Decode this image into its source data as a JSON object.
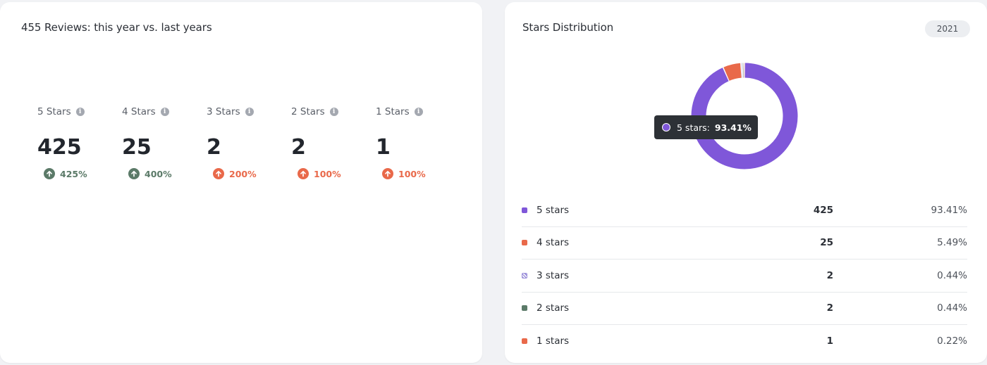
{
  "reviews_card": {
    "title": "455 Reviews: this year vs. last years",
    "stats": [
      {
        "label": "5 Stars",
        "value": "425",
        "change": "425%",
        "trend_color": "#5b7a68"
      },
      {
        "label": "4 Stars",
        "value": "25",
        "change": "400%",
        "trend_color": "#5b7a68"
      },
      {
        "label": "3 Stars",
        "value": "2",
        "change": "200%",
        "trend_color": "#e9694a"
      },
      {
        "label": "2 Stars",
        "value": "2",
        "change": "100%",
        "trend_color": "#e9694a"
      },
      {
        "label": "1 Stars",
        "value": "1",
        "change": "100%",
        "trend_color": "#e9694a"
      }
    ],
    "info_icon": "info-icon",
    "trend_icon": "arrow-up-circle-icon"
  },
  "distribution_card": {
    "title": "Stars Distribution",
    "year_badge": "2021",
    "tooltip": {
      "label": "5 stars:",
      "value": "93.41%"
    },
    "rows": [
      {
        "name": "5 stars",
        "count": "425",
        "pct": "93.41%",
        "color": "#7f57d9"
      },
      {
        "name": "4 stars",
        "count": "25",
        "pct": "5.49%",
        "color": "#e9694a"
      },
      {
        "name": "3 stars",
        "count": "2",
        "pct": "0.44%",
        "color": "#9b8fd9"
      },
      {
        "name": "2 stars",
        "count": "2",
        "pct": "0.44%",
        "color": "#5b7a68"
      },
      {
        "name": "1 stars",
        "count": "1",
        "pct": "0.22%",
        "color": "#e9694a"
      }
    ]
  },
  "chart_data": {
    "type": "pie",
    "donut": true,
    "categories": [
      "5 stars",
      "4 stars",
      "3 stars",
      "2 stars",
      "1 stars"
    ],
    "values": [
      425,
      25,
      2,
      2,
      1
    ],
    "percentages": [
      93.41,
      5.49,
      0.44,
      0.44,
      0.22
    ],
    "colors": [
      "#7f57d9",
      "#e9694a",
      "#9b8fd9",
      "#5b7a68",
      "#e9694a"
    ],
    "title": "Stars Distribution"
  }
}
